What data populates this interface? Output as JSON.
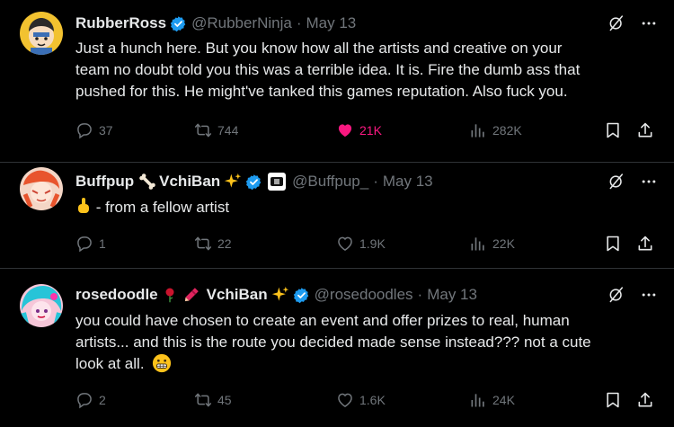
{
  "colors": {
    "background": "#000000",
    "text": "#e7e9ea",
    "muted": "#71767b",
    "like_active": "#f91880",
    "verified": "#1d9bf0",
    "divider": "#2f3336"
  },
  "tweets": [
    {
      "name": "RubberRoss",
      "name_suffix": "",
      "handle": "@RubberNinja",
      "dot": "·",
      "date": "May 13",
      "text_lines": [
        "Just a hunch here. But you know how all the artists and creative on your",
        "team no doubt told you this was a terrible idea. It is. Fire the dumb ass that",
        "pushed for this. He might've tanked this games reputation. Also fuck you."
      ],
      "replies": "37",
      "retweets": "744",
      "likes": "21K",
      "views": "282K",
      "liked": true,
      "icons": [
        "verified-badge-icon",
        "grok-icon",
        "more-icon",
        "reply-icon",
        "retweet-icon",
        "heart-icon",
        "views-icon",
        "bookmark-icon",
        "share-icon"
      ]
    },
    {
      "name": "Buffpup",
      "name_suffix": "VchiBan",
      "handle": "@Buffpup_",
      "dot": "·",
      "date": "May 13",
      "text_lines": [
        "- from a fellow artist"
      ],
      "replies": "1",
      "retweets": "22",
      "likes": "1.9K",
      "views": "22K",
      "liked": false,
      "icons": [
        "bone-emoji-icon",
        "sparkles-emoji-icon",
        "verified-badge-icon",
        "affiliate-badge-icon",
        "middle-finger-emoji-icon"
      ]
    },
    {
      "name": "rosedoodle",
      "name_suffix": "VchiBan",
      "handle": "@rosedoodles",
      "dot": "·",
      "date": "May 13",
      "text_lines": [
        "you could have chosen to create an event and offer prizes to real, human",
        "artists... and this is the route you decided made sense instead??? not a cute",
        "look at all."
      ],
      "replies": "2",
      "retweets": "45",
      "likes": "1.6K",
      "views": "24K",
      "liked": false,
      "icons": [
        "rose-emoji-icon",
        "crayon-emoji-icon",
        "sparkles-emoji-icon",
        "verified-badge-icon",
        "grimace-emoji-icon"
      ]
    }
  ]
}
